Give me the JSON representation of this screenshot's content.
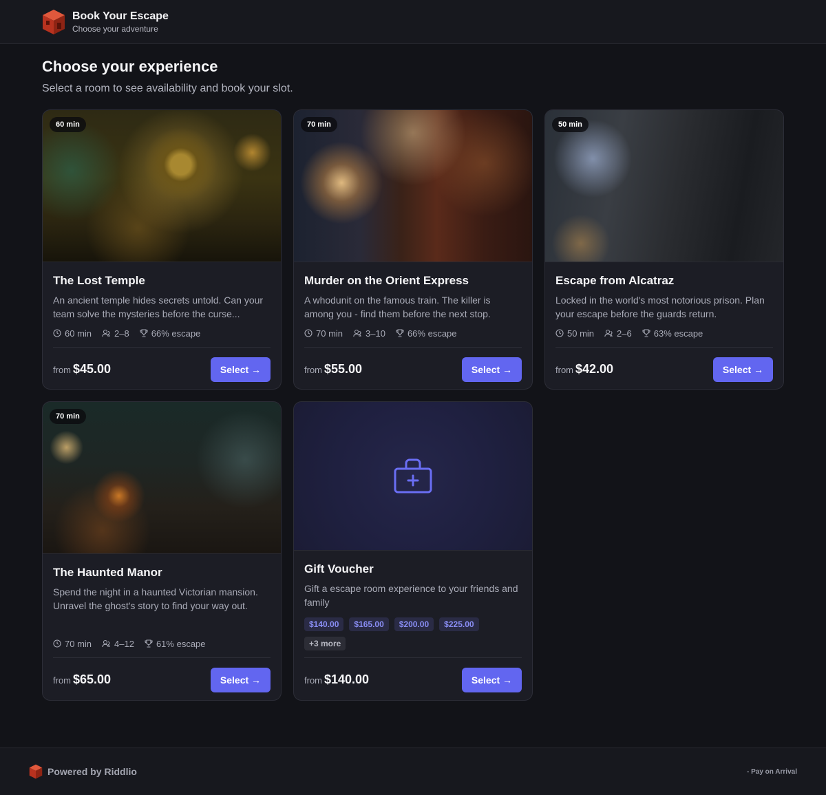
{
  "brand": {
    "title": "Book Your Escape",
    "subtitle": "Choose your adventure",
    "logo_icon": "cube-logo-icon"
  },
  "page": {
    "title": "Choose your experience",
    "subtitle": "Select a room to see availability and book your slot."
  },
  "rooms": [
    {
      "badge": "60 min",
      "title": "The Lost Temple",
      "description": "An ancient temple hides secrets untold. Can your team solve the mysteries before the curse...",
      "duration": "60 min",
      "players": "2–8",
      "escape": "66% escape",
      "from_label": "from",
      "price": "$45.00",
      "select_label": "Select →"
    },
    {
      "badge": "70 min",
      "title": "Murder on the Orient Express",
      "description": "A whodunit on the famous train. The killer is among you - find them before the next stop.",
      "duration": "70 min",
      "players": "3–10",
      "escape": "66% escape",
      "from_label": "from",
      "price": "$55.00",
      "select_label": "Select →"
    },
    {
      "badge": "50 min",
      "title": "Escape from Alcatraz",
      "description": "Locked in the world's most notorious prison. Plan your escape before the guards return.",
      "duration": "50 min",
      "players": "2–6",
      "escape": "63% escape",
      "from_label": "from",
      "price": "$42.00",
      "select_label": "Select →"
    },
    {
      "badge": "70 min",
      "title": "The Haunted Manor",
      "description": "Spend the night in a haunted Victorian mansion. Unravel the ghost's story to find your way out.",
      "duration": "70 min",
      "players": "4–12",
      "escape": "61% escape",
      "from_label": "from",
      "price": "$65.00",
      "select_label": "Select →"
    }
  ],
  "voucher": {
    "icon": "gift-bag-icon",
    "title": "Gift Voucher",
    "description": "Gift a escape room experience to your friends and family",
    "amounts": [
      "$140.00",
      "$165.00",
      "$200.00",
      "$225.00"
    ],
    "more": "+3 more",
    "from_label": "from",
    "price": "$140.00",
    "select_label": "Select →"
  },
  "footer": {
    "powered": "Powered by Riddlio",
    "payment": "- Pay on Arrival"
  },
  "colors": {
    "accent": "#6266f0",
    "background": "#121318",
    "card": "#1c1d25",
    "logo": "#c8402a"
  }
}
